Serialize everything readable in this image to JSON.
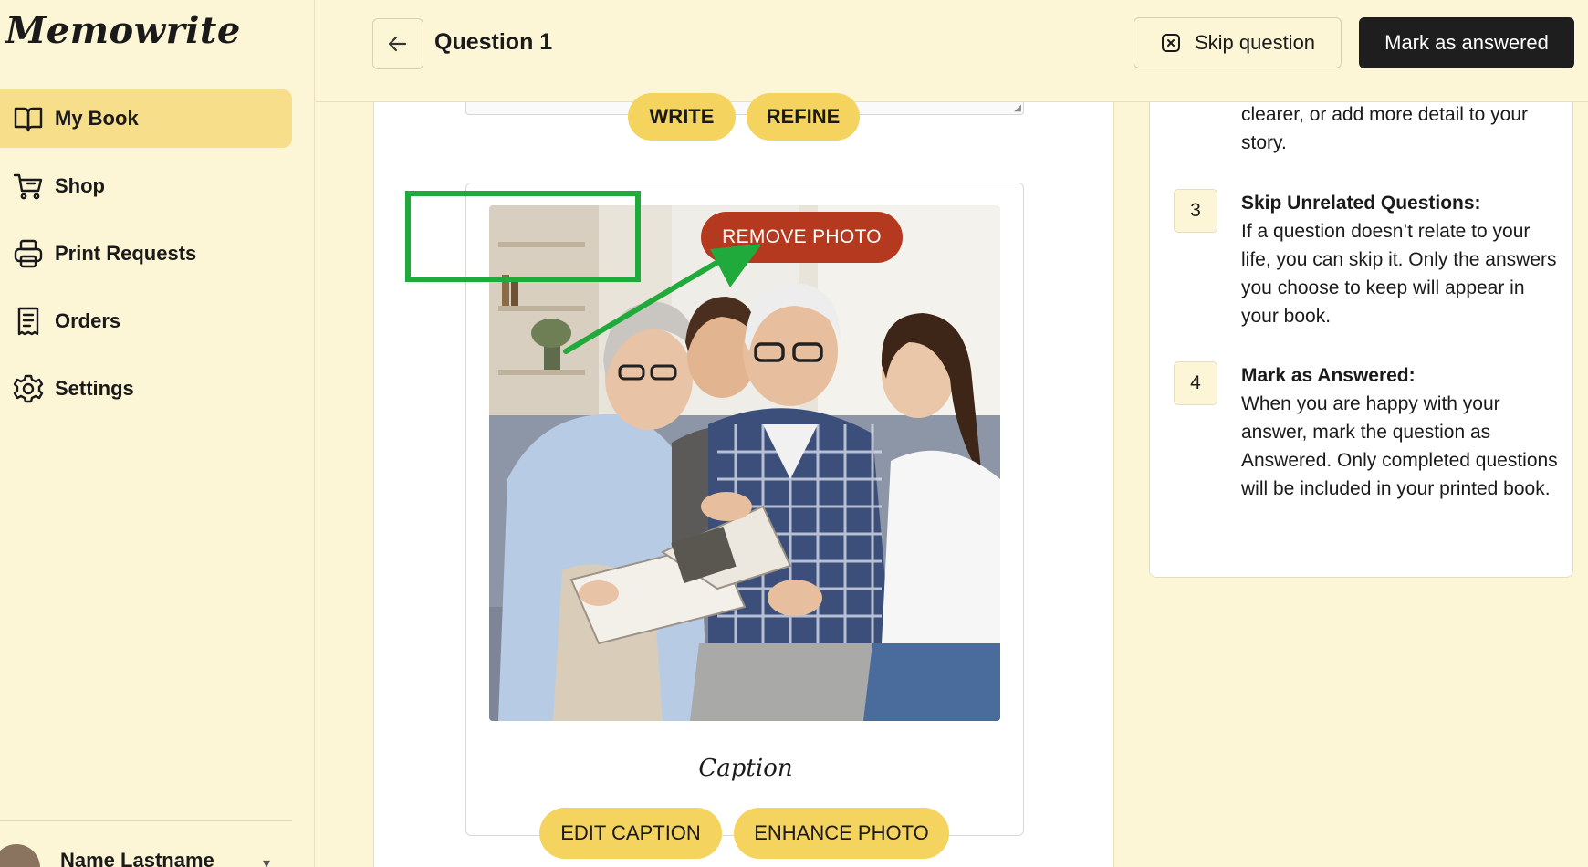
{
  "app": {
    "name": "Memowrite"
  },
  "sidebar": {
    "items": [
      {
        "label": "My Book",
        "icon": "book-icon",
        "active": true
      },
      {
        "label": "Shop",
        "icon": "cart-icon"
      },
      {
        "label": "Print Requests",
        "icon": "printer-icon"
      },
      {
        "label": "Orders",
        "icon": "receipt-icon"
      },
      {
        "label": "Settings",
        "icon": "gear-icon"
      }
    ],
    "user": {
      "name": "Name Lastname"
    }
  },
  "header": {
    "title": "Question 1",
    "skip_label": "Skip question",
    "mark_label": "Mark as answered"
  },
  "editor": {
    "write_label": "WRITE",
    "refine_label": "REFINE"
  },
  "photo_card": {
    "remove_label": "REMOVE PHOTO",
    "caption": "Caption",
    "edit_caption_label": "EDIT CAPTION",
    "enhance_label": "ENHANCE PHOTO"
  },
  "tips": {
    "continuation": "clearer, or add more detail to your story.",
    "items": [
      {
        "num": "3",
        "title": "Skip Unrelated Questions:",
        "body": "If a question doesn’t relate to your life, you can skip it. Only the answers you choose to keep will appear in your book."
      },
      {
        "num": "4",
        "title": "Mark as Answered:",
        "body": "When you are happy with your answer, mark the question as Answered. Only completed questions will be included in your printed book."
      }
    ]
  },
  "colors": {
    "background": "#FCF5D6",
    "active_nav": "#F6DE8A",
    "pill_button": "#F4D35E",
    "remove_button": "#B5391F",
    "primary_dark": "#1E1E1E",
    "highlight": "#1FAA3B"
  }
}
